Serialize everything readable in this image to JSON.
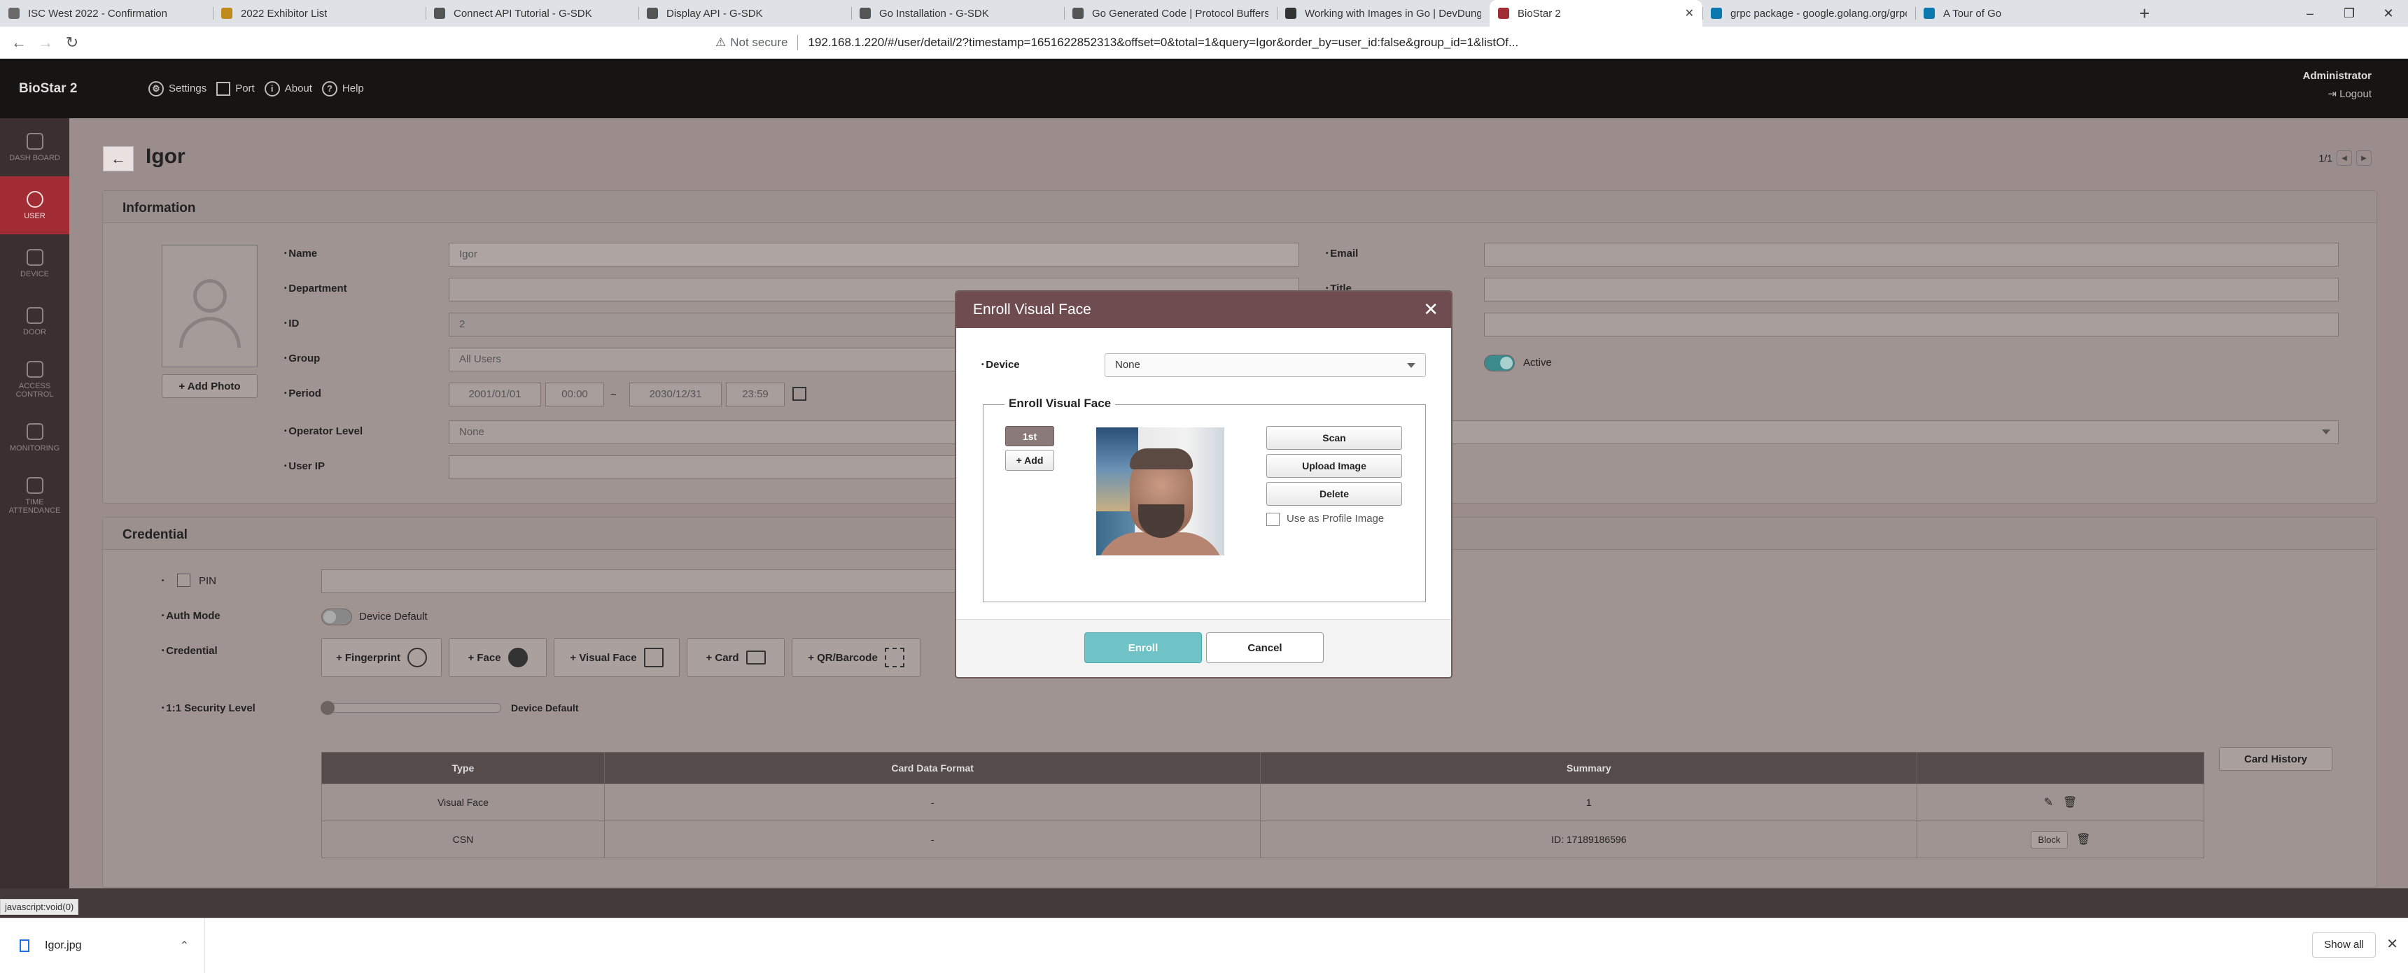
{
  "browser": {
    "tabs": [
      {
        "label": "ISC West 2022 - Confirmation",
        "favicon_color": "#6a6a6a"
      },
      {
        "label": "2022 Exhibitor List",
        "favicon_color": "#c08a1c"
      },
      {
        "label": "Connect API Tutorial - G-SDK",
        "favicon_color": "#555555"
      },
      {
        "label": "Display API - G-SDK",
        "favicon_color": "#555555"
      },
      {
        "label": "Go Installation - G-SDK",
        "favicon_color": "#555555"
      },
      {
        "label": "Go Generated Code | Protocol Buffers",
        "favicon_color": "#555555"
      },
      {
        "label": "Working with Images in Go | DevDungeon",
        "favicon_color": "#333333"
      },
      {
        "label": "BioStar 2",
        "favicon_color": "#a12c34"
      },
      {
        "label": "grpc package - google.golang.org/grpc",
        "favicon_color": "#0b79b0"
      },
      {
        "label": "A Tour of Go",
        "favicon_color": "#0b79b0"
      }
    ],
    "active_tab_index": 7,
    "new_tab": "+",
    "window_controls": [
      "–",
      "❐",
      "✕"
    ],
    "security_label": "Not secure",
    "url": "192.168.1.220/#/user/detail/2?timestamp=1651622852313&offset=0&total=1&query=Igor&order_by=user_id:false&group_id=1&listOf..."
  },
  "topnav": {
    "brand": "BioStar 2",
    "items": [
      {
        "label": "Settings",
        "icon": "gear-icon"
      },
      {
        "label": "Port",
        "icon": "network-icon"
      },
      {
        "label": "About",
        "icon": "info-icon"
      },
      {
        "label": "Help",
        "icon": "help-icon"
      }
    ],
    "user": "Administrator",
    "logout": "Logout"
  },
  "sidebar": {
    "items": [
      {
        "label": "DASH BOARD",
        "active": false
      },
      {
        "label": "USER",
        "active": true
      },
      {
        "label": "DEVICE",
        "active": false
      },
      {
        "label": "DOOR",
        "active": false
      },
      {
        "label": "ACCESS CONTROL",
        "active": false
      },
      {
        "label": "MONITORING",
        "active": false
      },
      {
        "label": "TIME ATTENDANCE",
        "active": false
      }
    ]
  },
  "page": {
    "user_name": "Igor",
    "pager": "1/1"
  },
  "information": {
    "title": "Information",
    "add_photo": "+ Add Photo",
    "name_label": "Name",
    "name_value": "Igor",
    "department_label": "Department",
    "department_value": "",
    "id_label": "ID",
    "id_value": "2",
    "group_label": "Group",
    "group_value": "All Users",
    "period_label": "Period",
    "period_start_date": "2001/01/01",
    "period_start_time": "00:00",
    "period_sep": "~",
    "period_end_date": "2030/12/31",
    "period_end_time": "23:59",
    "operator_label": "Operator Level",
    "operator_value": "None",
    "userip_label": "User IP",
    "email_label": "Email",
    "title_label": "Title",
    "status_value": "Active"
  },
  "credential": {
    "title": "Credential",
    "pin_label": "PIN",
    "auth_mode_label": "Auth Mode",
    "auth_mode_value": "Device Default",
    "credential_label": "Credential",
    "buttons": [
      "+ Fingerprint",
      "+ Face",
      "+ Visual Face",
      "+ Card",
      "+ QR/Barcode"
    ],
    "security_label": "1:1 Security Level",
    "security_value": "Device Default",
    "card_history": "Card History",
    "table_headers": [
      "Type",
      "Card Data Format",
      "Summary",
      ""
    ],
    "rows": [
      {
        "type": "Visual Face",
        "format": "-",
        "summary": "1",
        "action": ""
      },
      {
        "type": "CSN",
        "format": "-",
        "summary": "ID: 17189186596",
        "action": "Block"
      }
    ]
  },
  "modal": {
    "title": "Enroll Visual Face",
    "device_label": "Device",
    "device_value": "None",
    "section_title": "Enroll Visual Face",
    "slot_selected": "1st",
    "add": "+ Add",
    "scan": "Scan",
    "upload": "Upload Image",
    "delete": "Delete",
    "use_profile": "Use as Profile Image",
    "enroll": "Enroll",
    "cancel": "Cancel",
    "accent": "#6fc3c7"
  },
  "status_text": "javascript:void(0)",
  "download": {
    "file": "Igor.jpg",
    "show_all": "Show all"
  }
}
